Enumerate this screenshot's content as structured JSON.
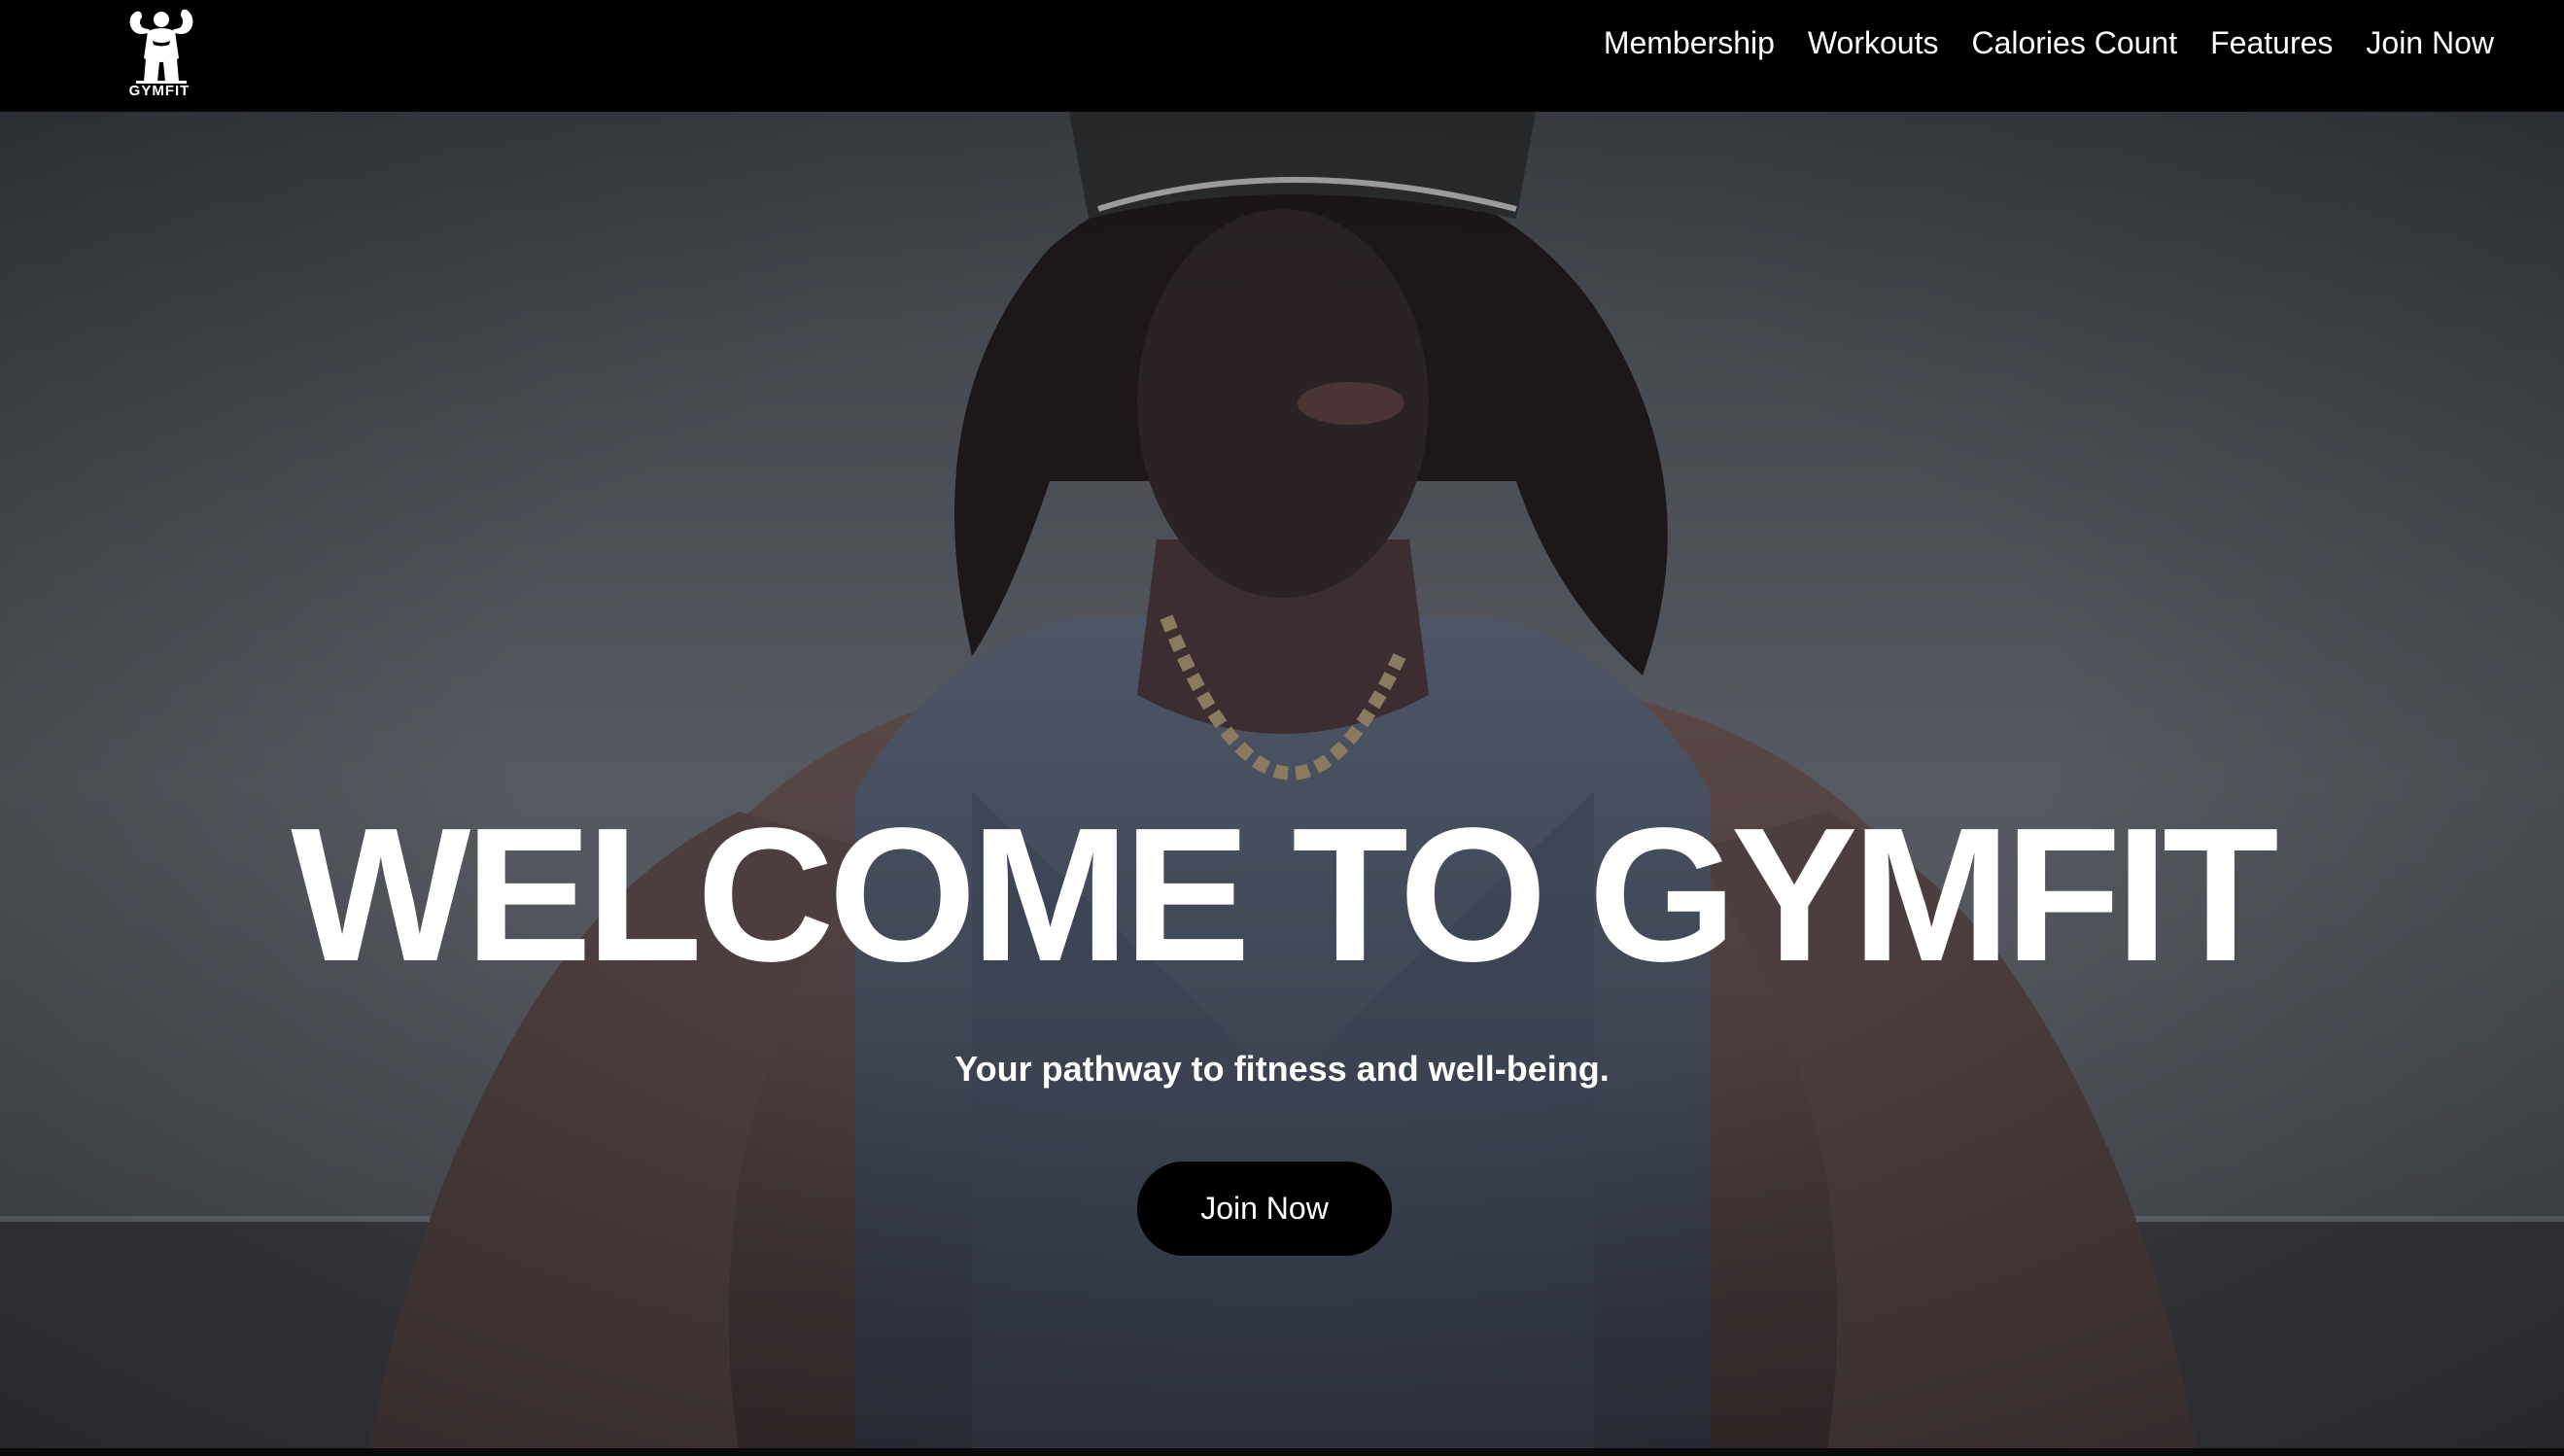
{
  "brand": {
    "logo_text": "GYMFIT",
    "logo_icon": "bodybuilder-icon"
  },
  "nav": {
    "items": [
      {
        "label": "Membership"
      },
      {
        "label": "Workouts"
      },
      {
        "label": "Calories Count"
      },
      {
        "label": "Features"
      },
      {
        "label": "Join Now"
      }
    ]
  },
  "hero": {
    "title": "WELCOME TO GYMFIT",
    "subtitle": "Your pathway to fitness and well-being.",
    "cta_label": "Join Now",
    "background": "muscular-man-in-tank-top-photo"
  },
  "colors": {
    "navbar": "#000000",
    "text": "#ffffff",
    "button": "#000000",
    "backdrop": "#4a4d53"
  }
}
